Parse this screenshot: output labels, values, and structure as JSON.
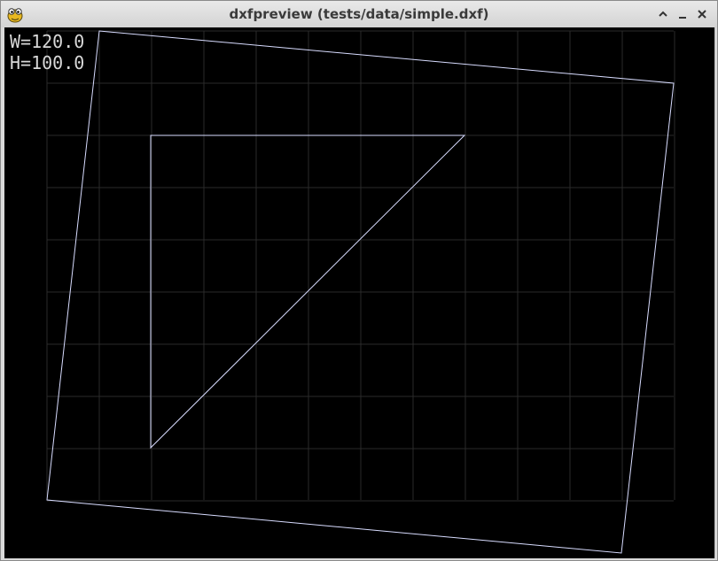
{
  "window": {
    "title": "dxfpreview (tests/data/simple.dxf)",
    "app_icon": "python-snake-icon"
  },
  "controls": {
    "maximize_icon": "chevron-up-icon",
    "minimize_icon": "minimize-icon",
    "close_icon": "close-icon"
  },
  "readout": {
    "width_text": "W=120.0",
    "height_text": "H=100.0"
  },
  "colors": {
    "background": "#000000",
    "grid": "#2a2a2a",
    "geometry": "#d8dcff"
  }
}
